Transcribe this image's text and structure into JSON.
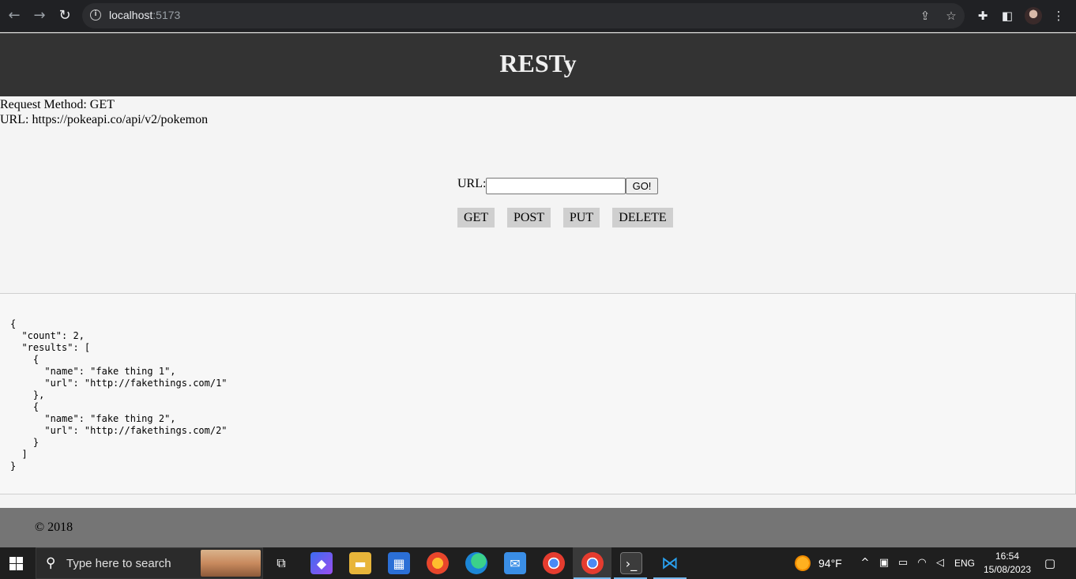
{
  "browser": {
    "url_host": "localhost",
    "url_port": ":5173"
  },
  "app": {
    "title": "RESTy",
    "request_method_line": "Request Method: GET",
    "url_line": "URL: https://pokeapi.co/api/v2/pokemon",
    "form": {
      "url_label": "URL:",
      "url_value": "",
      "go_label": "GO!",
      "methods": [
        "GET",
        "POST",
        "PUT",
        "DELETE"
      ]
    },
    "results_json": "{\n  \"count\": 2,\n  \"results\": [\n    {\n      \"name\": \"fake thing 1\",\n      \"url\": \"http://fakethings.com/1\"\n    },\n    {\n      \"name\": \"fake thing 2\",\n      \"url\": \"http://fakethings.com/2\"\n    }\n  ]\n}",
    "footer": "© 2018"
  },
  "taskbar": {
    "search_placeholder": "Type here to search",
    "weather": "94°F",
    "language": "ENG",
    "time": "16:54",
    "date": "15/08/2023"
  },
  "colors": {
    "header_bg": "#333333",
    "footer_bg": "#757575",
    "method_button_bg": "#cfcfcf"
  }
}
